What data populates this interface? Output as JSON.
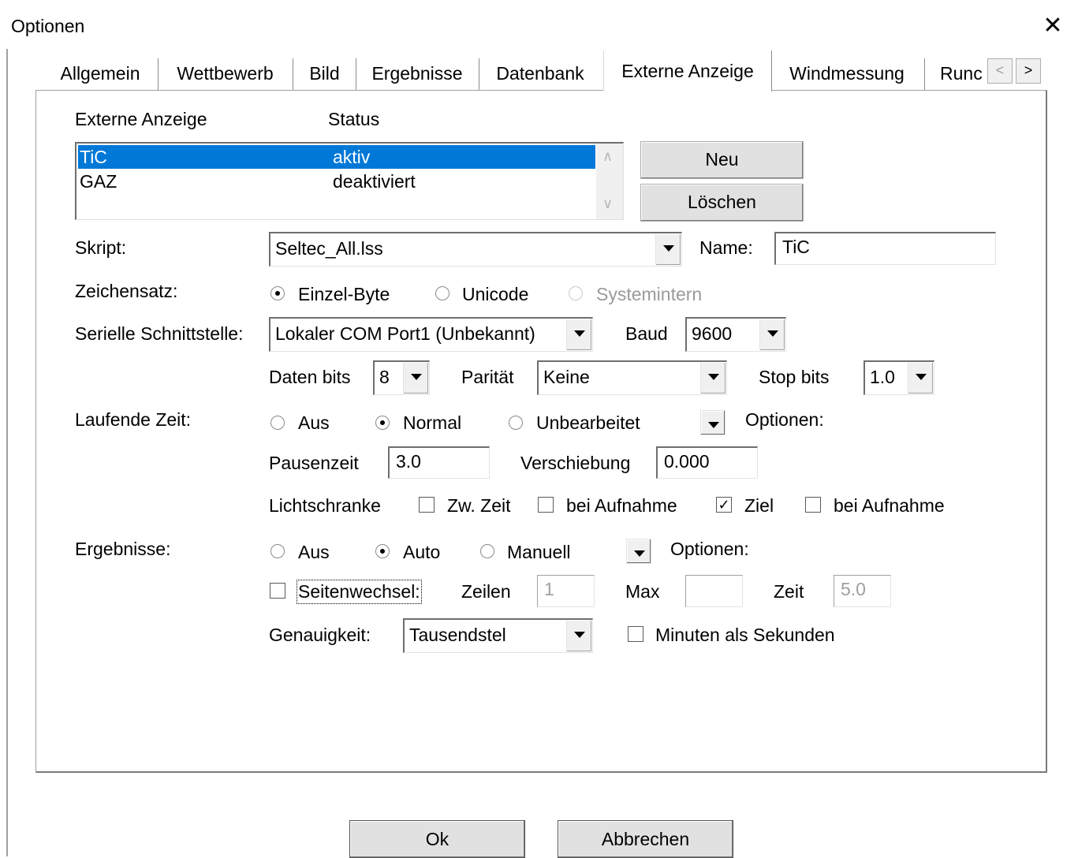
{
  "window": {
    "title": "Optionen",
    "close_glyph": "✕"
  },
  "tabs": [
    "Allgemein",
    "Wettbewerb",
    "Bild",
    "Ergebnisse",
    "Datenbank",
    "Externe Anzeige",
    "Windmessung",
    "Runc"
  ],
  "active_tab": "Externe Anzeige",
  "tab_scroll": {
    "left": "<",
    "right": ">"
  },
  "display_list": {
    "col_name": "Externe Anzeige",
    "col_status": "Status",
    "rows": [
      {
        "name": "TiC",
        "status": "aktiv"
      },
      {
        "name": "GAZ",
        "status": "deaktiviert"
      }
    ],
    "scroll_up": "∧",
    "scroll_down": "∨"
  },
  "buttons": {
    "new": "Neu",
    "delete": "Löschen",
    "ok": "Ok",
    "cancel": "Abbrechen"
  },
  "script": {
    "label": "Skript:",
    "value": "Seltec_All.lss"
  },
  "name": {
    "label": "Name:",
    "value": "TiC"
  },
  "charset": {
    "label": "Zeichensatz:",
    "options": [
      "Einzel-Byte",
      "Unicode",
      "Systemintern"
    ],
    "selected": "Einzel-Byte"
  },
  "serial": {
    "label": "Serielle Schnittstelle:",
    "port": "Lokaler COM Port1 (Unbekannt)",
    "baud_label": "Baud",
    "baud": "9600",
    "data_bits_label": "Daten bits",
    "data_bits": "8",
    "parity_label": "Parität",
    "parity": "Keine",
    "stop_bits_label": "Stop bits",
    "stop_bits": "1.0"
  },
  "running_time": {
    "label": "Laufende Zeit:",
    "options": [
      "Aus",
      "Normal",
      "Unbearbeitet"
    ],
    "selected": "Normal",
    "options_label": "Optionen:",
    "pause_label": "Pausenzeit",
    "pause": "3.0",
    "offset_label": "Verschiebung",
    "offset": "0.000",
    "light_barrier_label": "Lichtschranke",
    "split_time": {
      "label": "Zw. Zeit",
      "checked": false
    },
    "split_on_capture": {
      "label": "bei Aufnahme",
      "checked": false
    },
    "finish": {
      "label": "Ziel",
      "checked": true
    },
    "finish_on_capture": {
      "label": "bei Aufnahme",
      "checked": false
    }
  },
  "results": {
    "label": "Ergebnisse:",
    "options": [
      "Aus",
      "Auto",
      "Manuell"
    ],
    "selected": "Auto",
    "options_label": "Optionen:",
    "page_change": {
      "label": "Seitenwechsel:",
      "checked": false
    },
    "rows_label": "Zeilen",
    "rows": "1",
    "max_label": "Max",
    "max": "",
    "time_label": "Zeit",
    "time": "5.0",
    "precision_label": "Genauigkeit:",
    "precision": "Tausendstel",
    "minutes_as_seconds": {
      "label": "Minuten als Sekunden",
      "checked": false
    }
  },
  "colors": {
    "selection": "#0078d7",
    "disabled_text": "#9a9a9a"
  }
}
